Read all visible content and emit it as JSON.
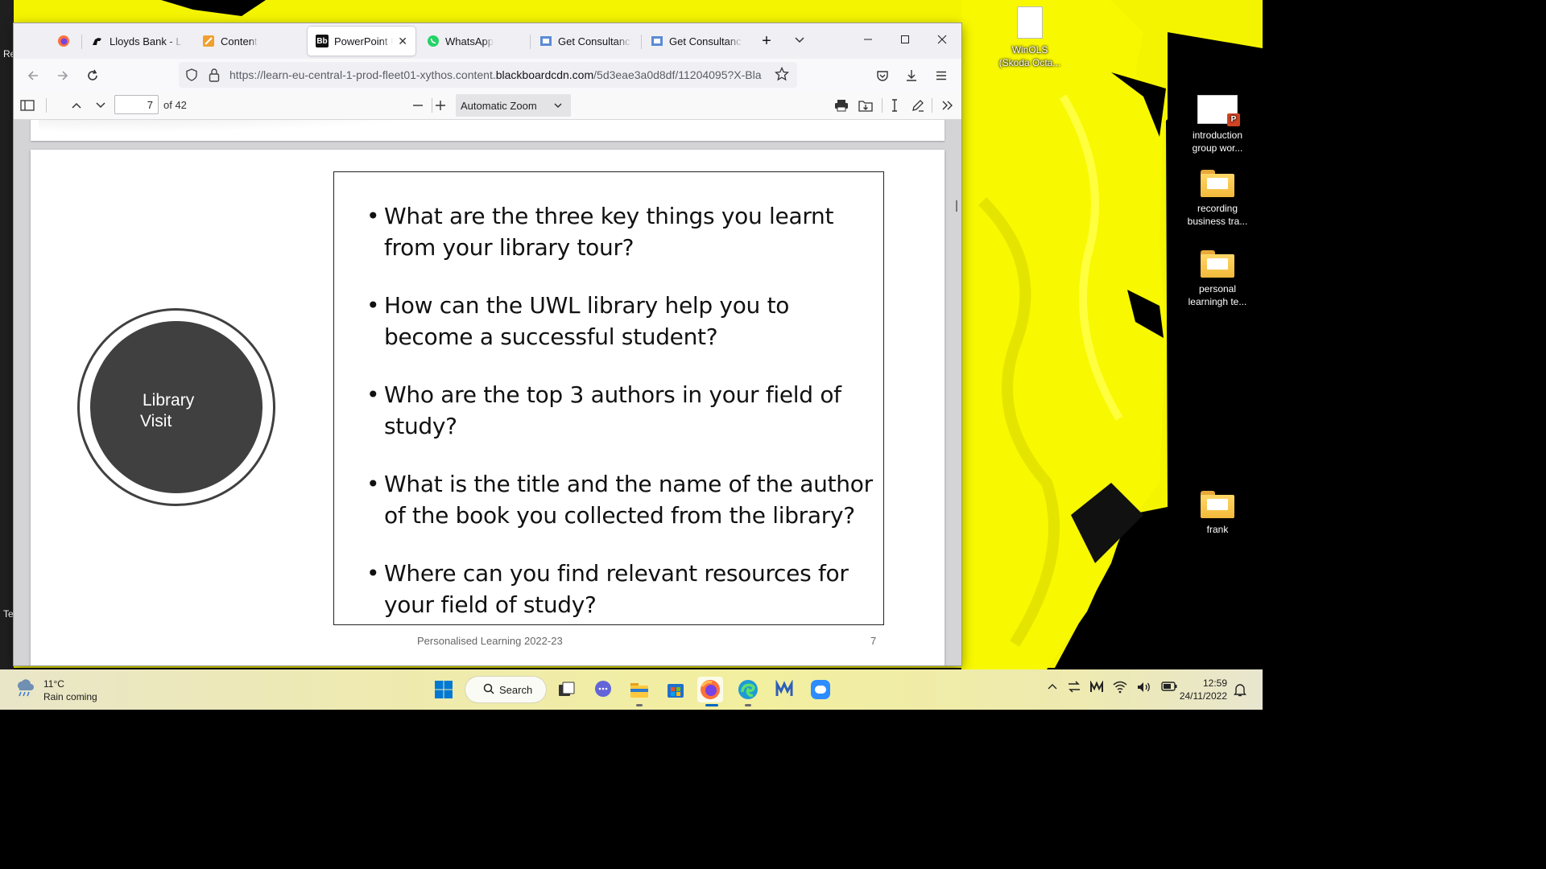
{
  "desktop": {
    "icons": [
      {
        "label_line1": "WinOLS",
        "label_line2": "(Skoda Octa..."
      },
      {
        "label_line1": "introduction",
        "label_line2": "group wor..."
      },
      {
        "label_line1": "recording",
        "label_line2": "business tra..."
      },
      {
        "label_line1": "personal",
        "label_line2": "learningh te..."
      },
      {
        "label_line1": "frank",
        "label_line2": ""
      }
    ]
  },
  "browser": {
    "tabs": [
      {
        "label": "Lloyds Bank - Log"
      },
      {
        "label": "Content"
      },
      {
        "label": "PowerPoint Pre"
      },
      {
        "label": "WhatsApp"
      },
      {
        "label": "Get Consultancy I"
      },
      {
        "label": "Get Consultancy I"
      }
    ],
    "new_tab": "+",
    "url_prefix": "https://learn-eu-central-1-prod-fleet01-xythos.content.",
    "url_domain": "blackboardcdn.com",
    "url_suffix": "/5d3eae3a0d8df/11204095?X-Bla"
  },
  "pdf_toolbar": {
    "page_value": "7",
    "page_count": "of 42",
    "zoom": "Automatic Zoom"
  },
  "slide": {
    "circle_line1": "Library",
    "circle_line2": "Visit",
    "questions": [
      "What are the three key things you learnt from your library tour?",
      "How can the UWL library help you to become a successful student?",
      "Who are the top 3 authors in your field of study?",
      "What is the title and the name of the author of the book you collected from the library?",
      "Where can you find relevant resources for your field of study?"
    ],
    "footer": "Personalised Learning 2022-23",
    "number": "7"
  },
  "taskbar": {
    "temperature": "11°C",
    "weather": "Rain coming",
    "search_label": "Search",
    "time": "12:59",
    "date": "24/11/2022"
  },
  "colors": {
    "wallpaper_yellow": "#f5f500",
    "slide_circle": "#404040",
    "accent_blue": "#0060df"
  }
}
